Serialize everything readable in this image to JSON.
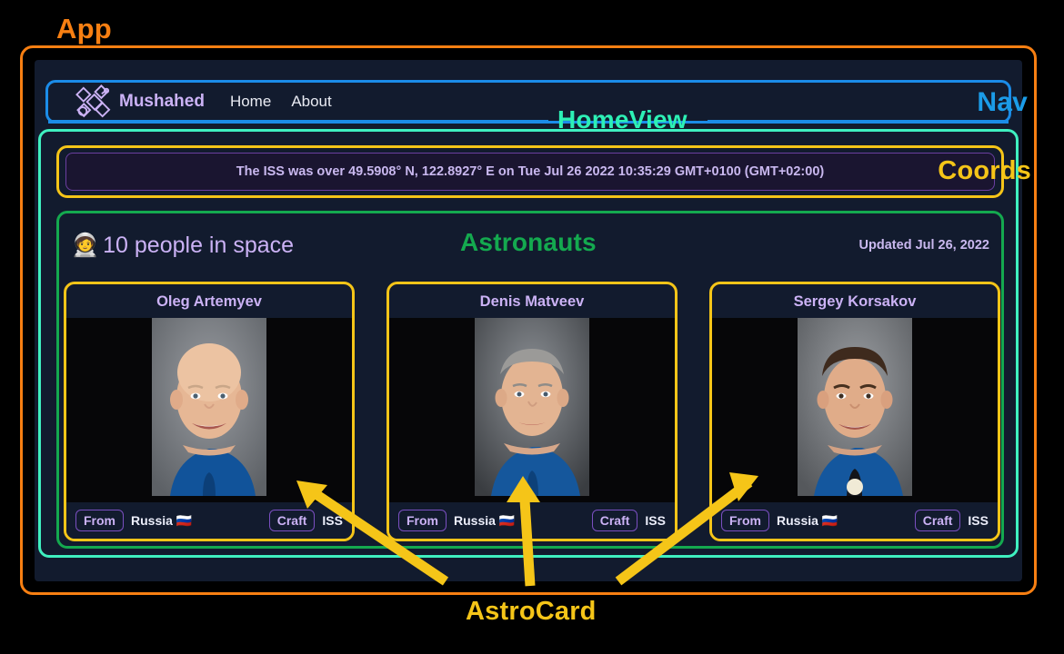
{
  "annotations": {
    "app": "App",
    "nav": "Nav",
    "homeview": "HomeView",
    "coords": "Coords",
    "astronauts": "Astronauts",
    "astrocard": "AstroCard"
  },
  "colors": {
    "app_border": "#f77f12",
    "nav_border": "#1b8ce8",
    "homeview_border": "#3ff0c0",
    "coords_border": "#f5c518",
    "astronauts_border": "#14a94f",
    "card_border": "#f5c518",
    "arrow": "#f5c518",
    "page_bg": "#000000",
    "panel_bg": "#121b2e",
    "accent_text": "#cbb2f5"
  },
  "navbar": {
    "brand": "Mushahed",
    "brand_icon": "satellite-icon",
    "links": [
      {
        "label": "Home"
      },
      {
        "label": "About"
      }
    ]
  },
  "coords": {
    "text": "The ISS was over 49.5908° N, 122.8927° E on Tue Jul 26 2022 10:35:29 GMT+0100 (GMT+02:00)"
  },
  "astronauts_section": {
    "emoji": "🧑‍🚀",
    "count_text": "10 people in space",
    "updated": "Updated Jul 26, 2022",
    "badges": {
      "from_label": "From",
      "craft_label": "Craft"
    },
    "cards": [
      {
        "name": "Oleg Artemyev",
        "country": "Russia 🇷🇺",
        "craft": "ISS"
      },
      {
        "name": "Denis Matveev",
        "country": "Russia 🇷🇺",
        "craft": "ISS"
      },
      {
        "name": "Sergey Korsakov",
        "country": "Russia 🇷🇺",
        "craft": "ISS"
      }
    ]
  }
}
